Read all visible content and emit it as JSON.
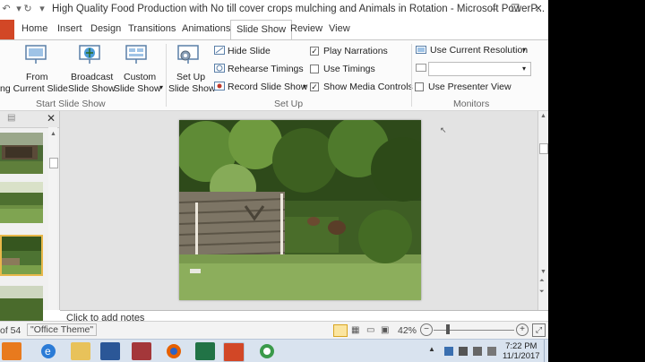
{
  "window": {
    "title": "High Quality Food Production with No till cover crops mulching and Animals in Rotation - Microsoft PowerP..."
  },
  "tabs": [
    {
      "label": "Home"
    },
    {
      "label": "Insert"
    },
    {
      "label": "Design"
    },
    {
      "label": "Transitions"
    },
    {
      "label": "Animations"
    },
    {
      "label": "Slide Show",
      "active": true
    },
    {
      "label": "Review"
    },
    {
      "label": "View"
    }
  ],
  "ribbon": {
    "start_group": {
      "label": "Start Slide Show",
      "from_current_top": "From",
      "from_current_bottom": "ng Current Slide",
      "broadcast_top": "Broadcast",
      "broadcast_bottom": "Slide Show",
      "custom_top": "Custom",
      "custom_bottom": "Slide Show"
    },
    "setup_group": {
      "label": "Set Up",
      "setup_top": "Set Up",
      "setup_bottom": "Slide Show",
      "hide_slide": "Hide Slide",
      "rehearse": "Rehearse Timings",
      "record": "Record Slide Show",
      "play_narrations": "Play Narrations",
      "use_timings": "Use Timings",
      "show_media": "Show Media Controls"
    },
    "monitors_group": {
      "label": "Monitors",
      "resolution": "Use Current Resolution",
      "presenter_view": "Use Presenter View"
    }
  },
  "checkboxes": {
    "play_narrations": true,
    "use_timings": false,
    "show_media_controls": true,
    "use_presenter_view": false
  },
  "notes": {
    "placeholder": "Click to add notes"
  },
  "status": {
    "slide_of": "of 54",
    "theme": "\"Office Theme\"",
    "zoom": "42%"
  },
  "taskbar": {
    "time": "7:22 PM",
    "date": "11/1/2017"
  },
  "colors": {
    "file_tab": "#d24726",
    "ribbon_bg": "#fbfbfb",
    "canvas_bg": "#e3e3e3",
    "taskbar_bg": "#d9e3ef"
  }
}
